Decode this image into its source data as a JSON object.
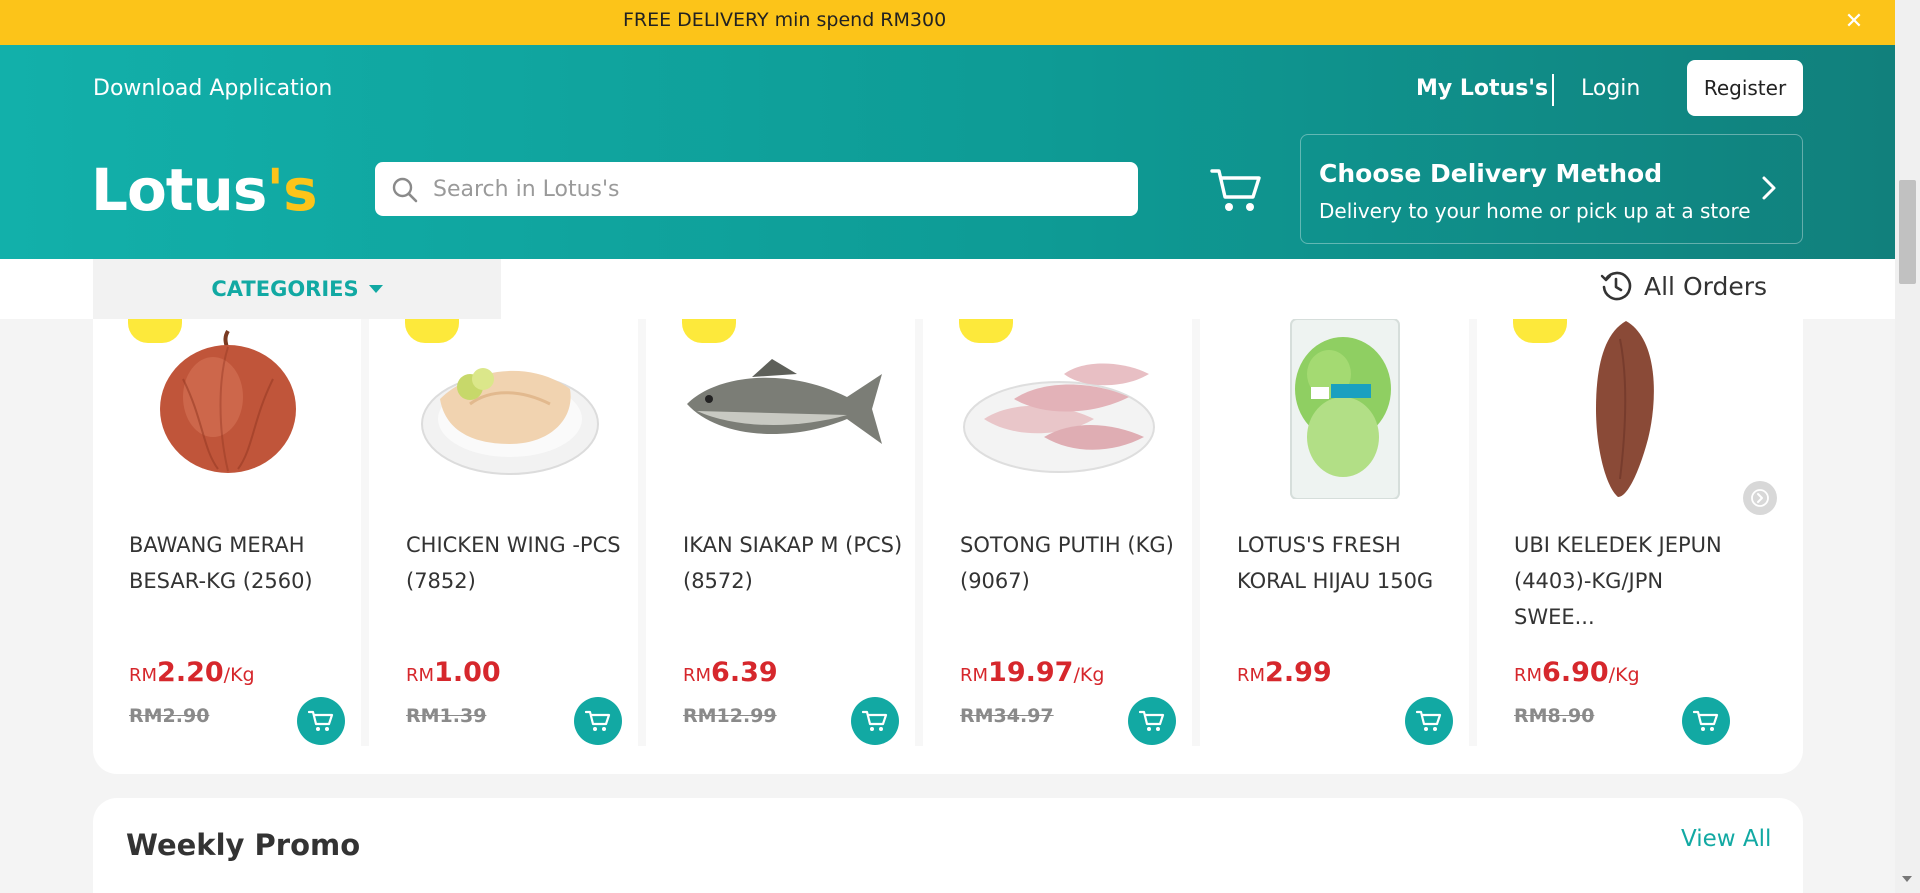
{
  "promo_bar": {
    "text": "FREE DELIVERY min spend RM300",
    "close_icon": "close-icon"
  },
  "header": {
    "download_app": "Download Application",
    "my_lotus": "My Lotus's",
    "login": "Login",
    "register": "Register",
    "logo_main": "Lotus",
    "logo_accent": "'s",
    "search_placeholder": "Search in Lotus's",
    "delivery_title": "Choose Delivery Method",
    "delivery_sub": "Delivery to your home or pick up at a store",
    "colors": {
      "teal": "#12b0aa",
      "yellow": "#fcc419"
    }
  },
  "nav": {
    "categories": "CATEGORIES",
    "all_orders": "All Orders"
  },
  "products": [
    {
      "name": "BAWANG MERAH BESAR-KG (2560)",
      "currency": "RM",
      "price": "2.20",
      "unit": "/Kg",
      "old_price": "RM2.90",
      "image": "red-onion",
      "has_discount": true
    },
    {
      "name": "CHICKEN WING -PCS (7852)",
      "currency": "RM",
      "price": "1.00",
      "unit": "",
      "old_price": "RM1.39",
      "image": "chicken-wing",
      "has_discount": true
    },
    {
      "name": "IKAN SIAKAP M (PCS) (8572)",
      "currency": "RM",
      "price": "6.39",
      "unit": "",
      "old_price": "RM12.99",
      "image": "fish",
      "has_discount": true
    },
    {
      "name": "SOTONG PUTIH (KG) (9067)",
      "currency": "RM",
      "price": "19.97",
      "unit": "/Kg",
      "old_price": "RM34.97",
      "image": "squid",
      "has_discount": true
    },
    {
      "name": "LOTUS'S FRESH KORAL HIJAU 150G",
      "currency": "RM",
      "price": "2.99",
      "unit": "",
      "old_price": "",
      "image": "lettuce",
      "has_discount": false
    },
    {
      "name": "UBI KELEDEK JEPUN (4403)-KG/JPN SWEE...",
      "currency": "RM",
      "price": "6.90",
      "unit": "/Kg",
      "old_price": "RM8.90",
      "image": "sweet-potato",
      "has_discount": true
    }
  ],
  "weekly_promo": {
    "title": "Weekly Promo",
    "view_all": "View All"
  },
  "price_color": "#d6272c"
}
